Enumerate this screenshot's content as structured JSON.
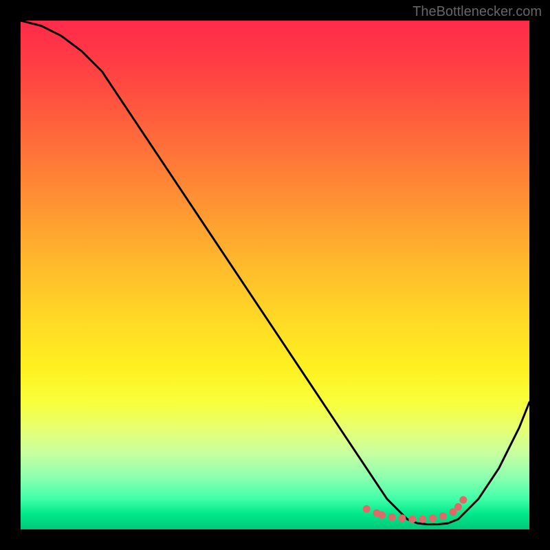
{
  "watermark": "TheBottlenecker.com",
  "chart_data": {
    "type": "line",
    "title": "",
    "xlabel": "",
    "ylabel": "",
    "xlim": [
      0,
      100
    ],
    "ylim": [
      0,
      100
    ],
    "series": [
      {
        "name": "curve",
        "x": [
          0,
          4,
          8,
          12,
          16,
          20,
          24,
          28,
          32,
          36,
          40,
          44,
          48,
          52,
          56,
          60,
          64,
          68,
          70,
          72,
          74,
          76,
          78,
          80,
          82,
          84,
          86,
          90,
          94,
          98,
          100
        ],
        "y": [
          100,
          99,
          97,
          94,
          90,
          84,
          78,
          72,
          66,
          60,
          54,
          48,
          42,
          36,
          30,
          24,
          18,
          12,
          9,
          6,
          4,
          2,
          1.2,
          1.0,
          1.0,
          1.2,
          2,
          6,
          12,
          20,
          25
        ]
      }
    ],
    "markers": {
      "name": "dots",
      "x": [
        68,
        70,
        71,
        73,
        75,
        77,
        79,
        81,
        83,
        85,
        86,
        87
      ],
      "y": [
        4,
        3.2,
        2.8,
        2.4,
        2.2,
        2.0,
        2.0,
        2.2,
        2.6,
        3.4,
        4.4,
        5.8
      ]
    },
    "gradient_stops": [
      {
        "pos": 0,
        "color": "#ff2a4a"
      },
      {
        "pos": 50,
        "color": "#ffd726"
      },
      {
        "pos": 80,
        "color": "#f8ff3a"
      },
      {
        "pos": 100,
        "color": "#00c878"
      }
    ]
  }
}
